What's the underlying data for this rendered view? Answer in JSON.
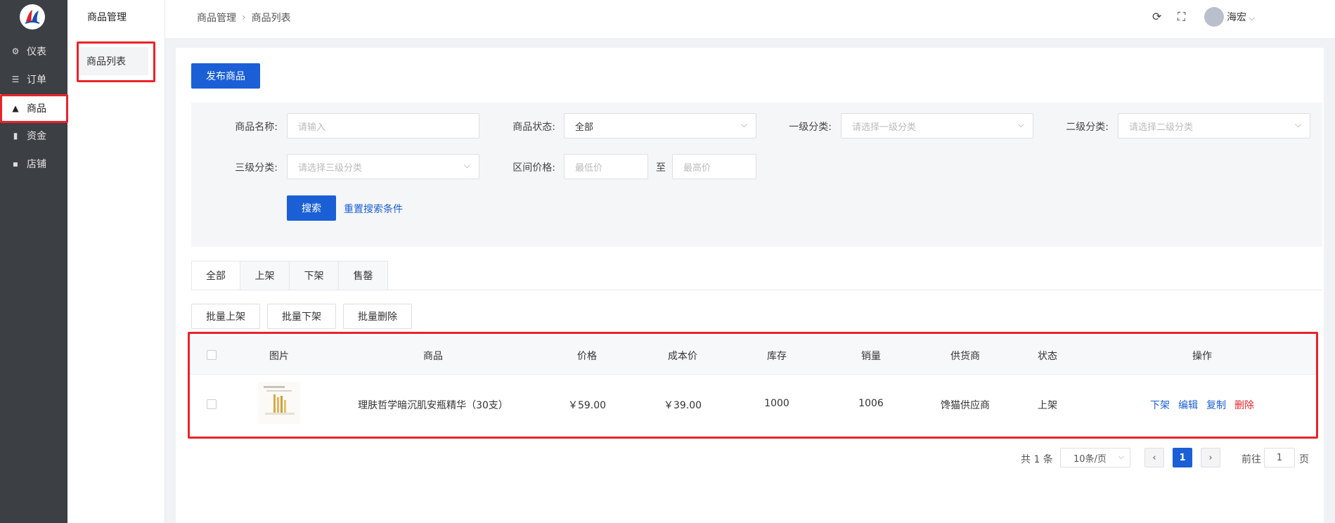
{
  "sidebar": {
    "items": [
      {
        "label": "仪表",
        "icon": "gear-icon"
      },
      {
        "label": "订单",
        "icon": "list-icon"
      },
      {
        "label": "商品",
        "icon": "bag-icon"
      },
      {
        "label": "资金",
        "icon": "money-icon"
      },
      {
        "label": "店铺",
        "icon": "store-icon"
      }
    ],
    "active_index": 2
  },
  "subsidebar": {
    "title": "商品管理",
    "items": [
      {
        "label": "商品列表"
      }
    ]
  },
  "header": {
    "breadcrumb": [
      "商品管理",
      "商品列表"
    ],
    "username": "海宏"
  },
  "toolbar": {
    "publish_label": "发布商品"
  },
  "filters": {
    "name_label": "商品名称:",
    "name_placeholder": "请输入",
    "status_label": "商品状态:",
    "status_value": "全部",
    "cat1_label": "一级分类:",
    "cat1_placeholder": "请选择一级分类",
    "cat2_label": "二级分类:",
    "cat2_placeholder": "请选择二级分类",
    "cat3_label": "三级分类:",
    "cat3_placeholder": "请选择三级分类",
    "price_label": "区间价格:",
    "price_min_placeholder": "最低价",
    "price_to": "至",
    "price_max_placeholder": "最高价",
    "search_label": "搜索",
    "reset_label": "重置搜索条件"
  },
  "tabs": [
    {
      "label": "全部"
    },
    {
      "label": "上架"
    },
    {
      "label": "下架"
    },
    {
      "label": "售罄"
    }
  ],
  "bulk": {
    "on_shelf": "批量上架",
    "off_shelf": "批量下架",
    "delete": "批量删除"
  },
  "table": {
    "headers": [
      "图片",
      "商品",
      "价格",
      "成本价",
      "库存",
      "销量",
      "供货商",
      "状态",
      "操作"
    ],
    "rows": [
      {
        "product": "理肤哲学暗沉肌安瓶精华（30支）",
        "price": "￥59.00",
        "cost": "￥39.00",
        "stock": "1000",
        "sales": "1006",
        "supplier": "馋猫供应商",
        "status": "上架",
        "ops": [
          "下架",
          "编辑",
          "复制",
          "删除"
        ]
      }
    ]
  },
  "pagination": {
    "total": "共 1 条",
    "page_size": "10条/页",
    "current": "1",
    "goto_label": "前往",
    "goto_value": "1",
    "page_suffix": "页"
  },
  "colors": {
    "primary": "#1a5fd6",
    "danger": "#e8242a",
    "sidebar": "#3c3f43"
  }
}
